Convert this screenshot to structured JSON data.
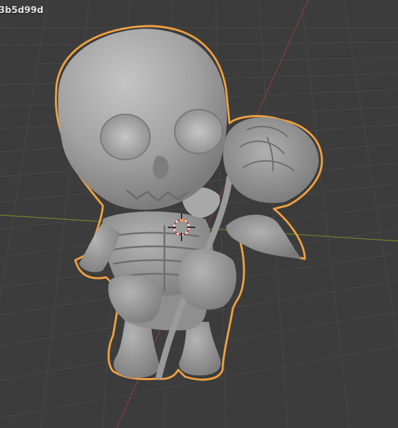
{
  "viewport": {
    "object_name": "3b5d99d",
    "colors": {
      "background": "#3c3c3c",
      "grid": "#474747",
      "x_axis": "#8b3a4a",
      "y_axis": "#6a8a2a",
      "selection_outline": "#f0a040",
      "mesh": "#9a9a9a"
    },
    "selected_object": "skeleton-holding-rose"
  }
}
